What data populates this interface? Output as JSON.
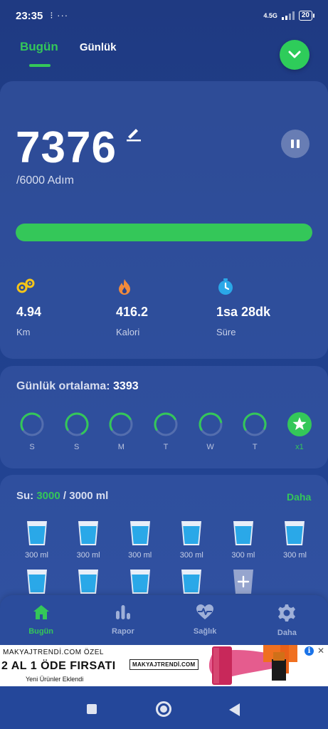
{
  "status_bar": {
    "time": "23:35",
    "notif_icons": "⁝ ···",
    "network": "4.5G",
    "battery": "20"
  },
  "tabs": [
    {
      "label": "Bugün",
      "active": true
    },
    {
      "label": "Günlük",
      "active": false
    }
  ],
  "steps": {
    "count": "7376",
    "goal_text": "/6000 Adım",
    "progress": 1.0
  },
  "stats": [
    {
      "icon": "distance-icon",
      "value": "4.94",
      "label": "Km"
    },
    {
      "icon": "flame-icon",
      "value": "416.2",
      "label": "Kalori"
    },
    {
      "icon": "timer-icon",
      "value": "1sa 28dk",
      "label": "Süre"
    }
  ],
  "daily_average": {
    "label": "Günlük ortalama:",
    "value": "3393"
  },
  "week": [
    {
      "label": "S",
      "progress": 0.45
    },
    {
      "label": "S",
      "progress": 0.75
    },
    {
      "label": "M",
      "progress": 0.5
    },
    {
      "label": "T",
      "progress": 0.5
    },
    {
      "label": "W",
      "progress": 0.55
    },
    {
      "label": "T",
      "progress": 0.65
    },
    {
      "label": "x1",
      "star": true
    }
  ],
  "water": {
    "label": "Su:",
    "current": "3000",
    "total": "/ 3000 ml",
    "more_link": "Daha",
    "cups": [
      "300 ml",
      "300 ml",
      "300 ml",
      "300 ml",
      "300 ml",
      "300 ml",
      "",
      "",
      "",
      "",
      ""
    ]
  },
  "bottom_nav": [
    {
      "label": "Bugün",
      "icon": "home-icon",
      "active": true
    },
    {
      "label": "Rapor",
      "icon": "bar-chart-icon",
      "active": false
    },
    {
      "label": "Sağlık",
      "icon": "heart-pulse-icon",
      "active": false
    },
    {
      "label": "Daha",
      "icon": "gear-icon",
      "active": false
    }
  ],
  "ad": {
    "brand": "MAKYAJTRENDİ.COM ÖZEL",
    "headline": "2 AL 1 ÖDE FIRSATI",
    "subline": "Yeni Ürünler Eklendi",
    "logo": "MAKYAJTRENDİ.COM",
    "info": "i",
    "close": "✕"
  },
  "colors": {
    "accent": "#34c759",
    "background": "#20408c",
    "water": "#2aa8e8"
  }
}
